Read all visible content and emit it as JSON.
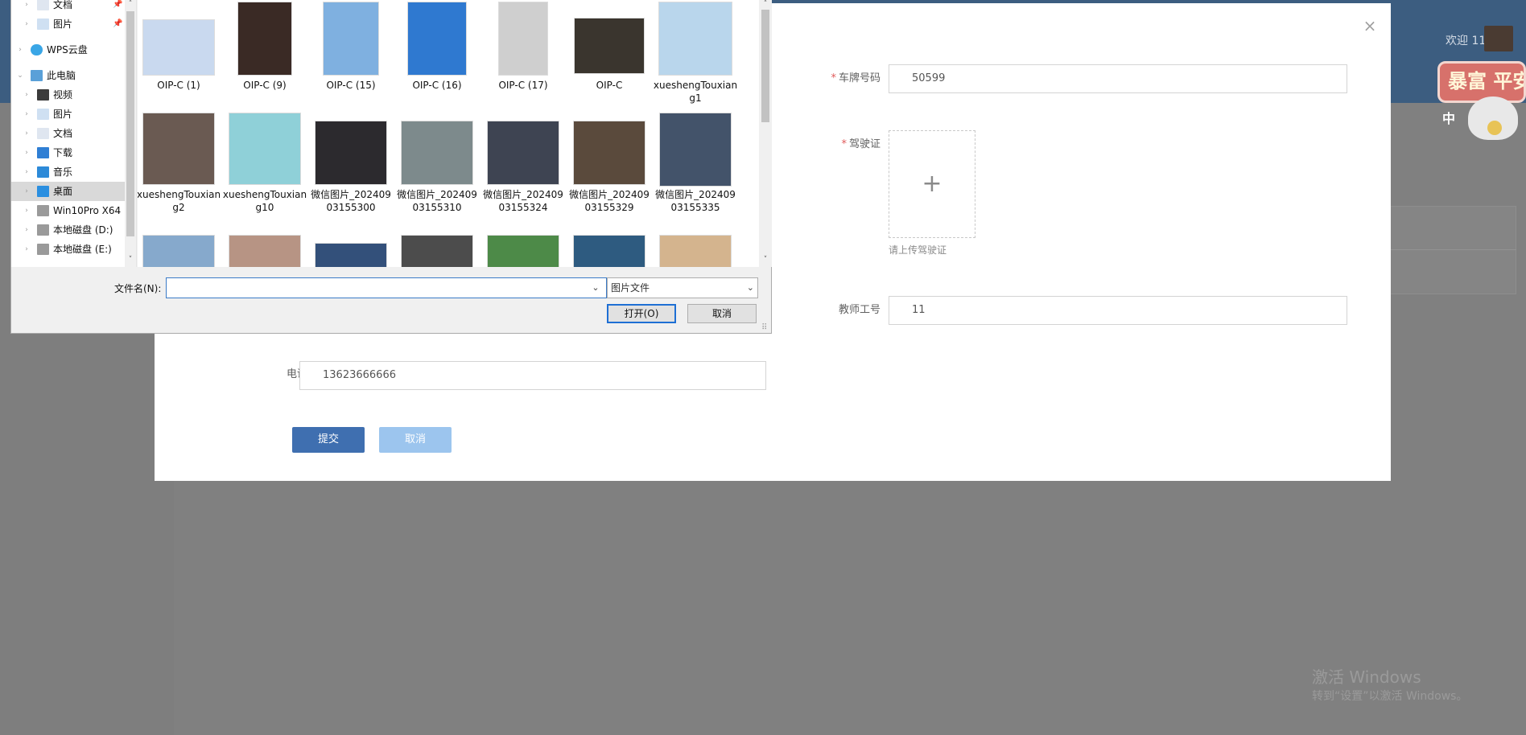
{
  "background": {
    "welcome_text": "欢迎 11",
    "sticker_text": "暴富 平安",
    "sticker_sub": "中",
    "watermark_title": "激活 Windows",
    "watermark_sub": "转到“设置”以激活 Windows。"
  },
  "modal": {
    "close_glyph": "×",
    "fields": {
      "plate": {
        "label": "车牌号码",
        "value": "50599",
        "required": true
      },
      "license": {
        "label": "驾驶证",
        "hint": "请上传驾驶证",
        "required": true,
        "plus": "+"
      },
      "teacher_no": {
        "label": "教师工号",
        "value": "11"
      },
      "phone": {
        "label": "电话",
        "value": "13623666666"
      }
    },
    "required_mark": "*",
    "submit_label": "提交",
    "cancel_label": "取消"
  },
  "file_dialog": {
    "nav": [
      {
        "label": "文档",
        "icon": "document-icon",
        "pinned": true
      },
      {
        "label": "图片",
        "icon": "picture-icon",
        "pinned": true
      },
      {
        "label": "WPS云盘",
        "icon": "cloud-icon"
      },
      {
        "label": "此电脑",
        "icon": "computer-icon",
        "expanded": true
      },
      {
        "label": "视频",
        "icon": "video-icon"
      },
      {
        "label": "图片",
        "icon": "picture-icon"
      },
      {
        "label": "文档",
        "icon": "document-icon"
      },
      {
        "label": "下载",
        "icon": "download-icon"
      },
      {
        "label": "音乐",
        "icon": "music-icon"
      },
      {
        "label": "桌面",
        "icon": "desktop-icon",
        "selected": true
      },
      {
        "label": "Win10Pro X64",
        "icon": "drive-icon"
      },
      {
        "label": "本地磁盘 (D:)",
        "icon": "drive-icon"
      },
      {
        "label": "本地磁盘 (E:)",
        "icon": "drive-icon"
      }
    ],
    "pin_glyph": "📌",
    "expand_glyph": "›",
    "collapse_glyph": "⌄",
    "files": [
      {
        "name": "OIP-C (1)",
        "color": "#c9d9ef"
      },
      {
        "name": "OIP-C (9)",
        "color": "#3a2a25"
      },
      {
        "name": "OIP-C (15)",
        "color": "#7fb0e0"
      },
      {
        "name": "OIP-C (16)",
        "color": "#2f79d0"
      },
      {
        "name": "OIP-C (17)",
        "color": "#cfcfcf"
      },
      {
        "name": "OIP-C",
        "color": "#3a352e"
      },
      {
        "name": "xueshengTouxiang1",
        "color": "#b9d6ec"
      },
      {
        "name": "xueshengTouxiang2",
        "color": "#6a5a52"
      },
      {
        "name": "xueshengTouxiang10",
        "color": "#8fd0d8"
      },
      {
        "name": "微信图片_20240903155300",
        "color": "#2c2a2e"
      },
      {
        "name": "微信图片_20240903155310",
        "color": "#7d8a8c"
      },
      {
        "name": "微信图片_20240903155324",
        "color": "#3e4452"
      },
      {
        "name": "微信图片_20240903155329",
        "color": "#5a4a3c"
      },
      {
        "name": "微信图片_20240903155335",
        "color": "#43536a"
      },
      {
        "name": "",
        "color": "#86a9cc"
      },
      {
        "name": "",
        "color": "#b79484"
      },
      {
        "name": "",
        "color": "#33507a"
      },
      {
        "name": "",
        "color": "#4c4c4c"
      },
      {
        "name": "",
        "color": "#4d8a48"
      },
      {
        "name": "",
        "color": "#2e5b80"
      },
      {
        "name": "",
        "color": "#d4b48e"
      }
    ],
    "filename_label": "文件名(N):",
    "filename_value": "",
    "filetype_value": "图片文件",
    "open_label": "打开(O)",
    "cancel_label": "取消",
    "dropdown_glyph": "⌄",
    "scroll_up_glyph": "˄",
    "scroll_down_glyph": "˅",
    "grip_glyph": "⠿"
  }
}
